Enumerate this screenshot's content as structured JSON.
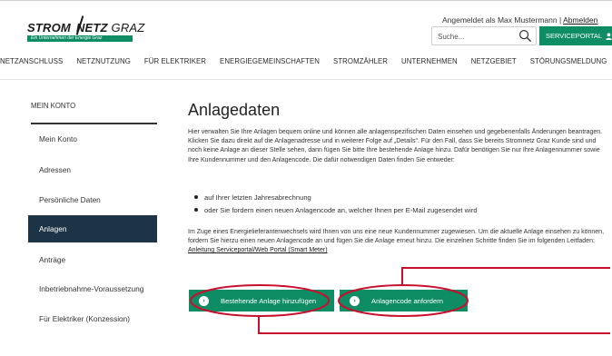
{
  "header": {
    "logo_name": "STROM/NETZ GRAZ",
    "logo_part_a": "STROM",
    "logo_part_b": "NETZ",
    "logo_part_c": " GRAZ",
    "logo_tagline": "Ein Unternehmen der Energie Graz",
    "logged_in_prefix": "Angemeldet als Max Mustermann | ",
    "logout_label": "Abmelden",
    "search_placeholder": "Suche...",
    "serviceportal_label": "SERVICEPORTAL"
  },
  "nav": {
    "items": [
      "NETZANSCHLUSS",
      "NETZNUTZUNG",
      "FÜR ELEKTRIKER",
      "ENERGIEGEMEINSCHAFTEN",
      "STROMZÄHLER",
      "UNTERNEHMEN",
      "NETZGEBIET",
      "STÖRUNGSMELDUNG"
    ]
  },
  "sidebar": {
    "title": "MEIN KONTO",
    "items": [
      {
        "label": "Mein Konto",
        "active": false
      },
      {
        "label": "Adressen",
        "active": false
      },
      {
        "label": "Persönliche Daten",
        "active": false
      },
      {
        "label": "Anlagen",
        "active": true
      },
      {
        "label": "Anträge",
        "active": false
      },
      {
        "label": "Inbetriebnahme-Voraussetzung",
        "active": false
      },
      {
        "label": "Für Elektriker (Konzession)",
        "active": false
      }
    ]
  },
  "main": {
    "title": "Anlagedaten",
    "para1": "Hier verwalten Sie Ihre Anlagen bequem online und können alle anlagenspezifischen Daten einsehen und gegebenenfalls Änderungen beantragen. Klicken Sie dazu direkt auf die Anlagenadresse und in weiterer Folge auf „Details“. Für den Fall, dass Sie bereits Stromnetz Graz Kunde sind und noch keine Anlage an dieser Stelle sehen, dann fügen Sie bitte Ihre bestehende Anlage hinzu. Dafür benötigen Sie nur Ihre Anlagennummer sowie Ihre Kundennummer und den Anlagencode. Die dafür notwendigen Daten finden Sie entweder:",
    "bullets": [
      "auf Ihrer letzten Jahresabrechnung",
      "oder Sie fordern einen neuen Anlagencode an, welcher Ihnen per E-Mail zugesendet wird"
    ],
    "para2": "Im Zuge eines Energielieferantenwechsels wird Ihnen von uns eine neue Kundennummer zugewiesen. Um die aktuelle Anlage einsehen zu können, fordern Sie hierzu einen neuen Anlagencode an und fügen Sie die Anlage erneut hinzu. Die einzelnen Schritte finden Sie im folgenden Leitfaden:",
    "guide_link": "Anleitung Serviceportal/Web Portal (Smart Meter)",
    "btn_add": "Bestehende Anlage hinzufügen",
    "btn_request": "Anlagencode anfordern"
  },
  "colors": {
    "brand_green": "#0e8c63",
    "sidebar_active": "#1d3446",
    "annotation_red": "#c8102e"
  },
  "icons": {
    "search": "search-icon",
    "user": "user-icon",
    "arrow": "chevron-right-icon"
  }
}
